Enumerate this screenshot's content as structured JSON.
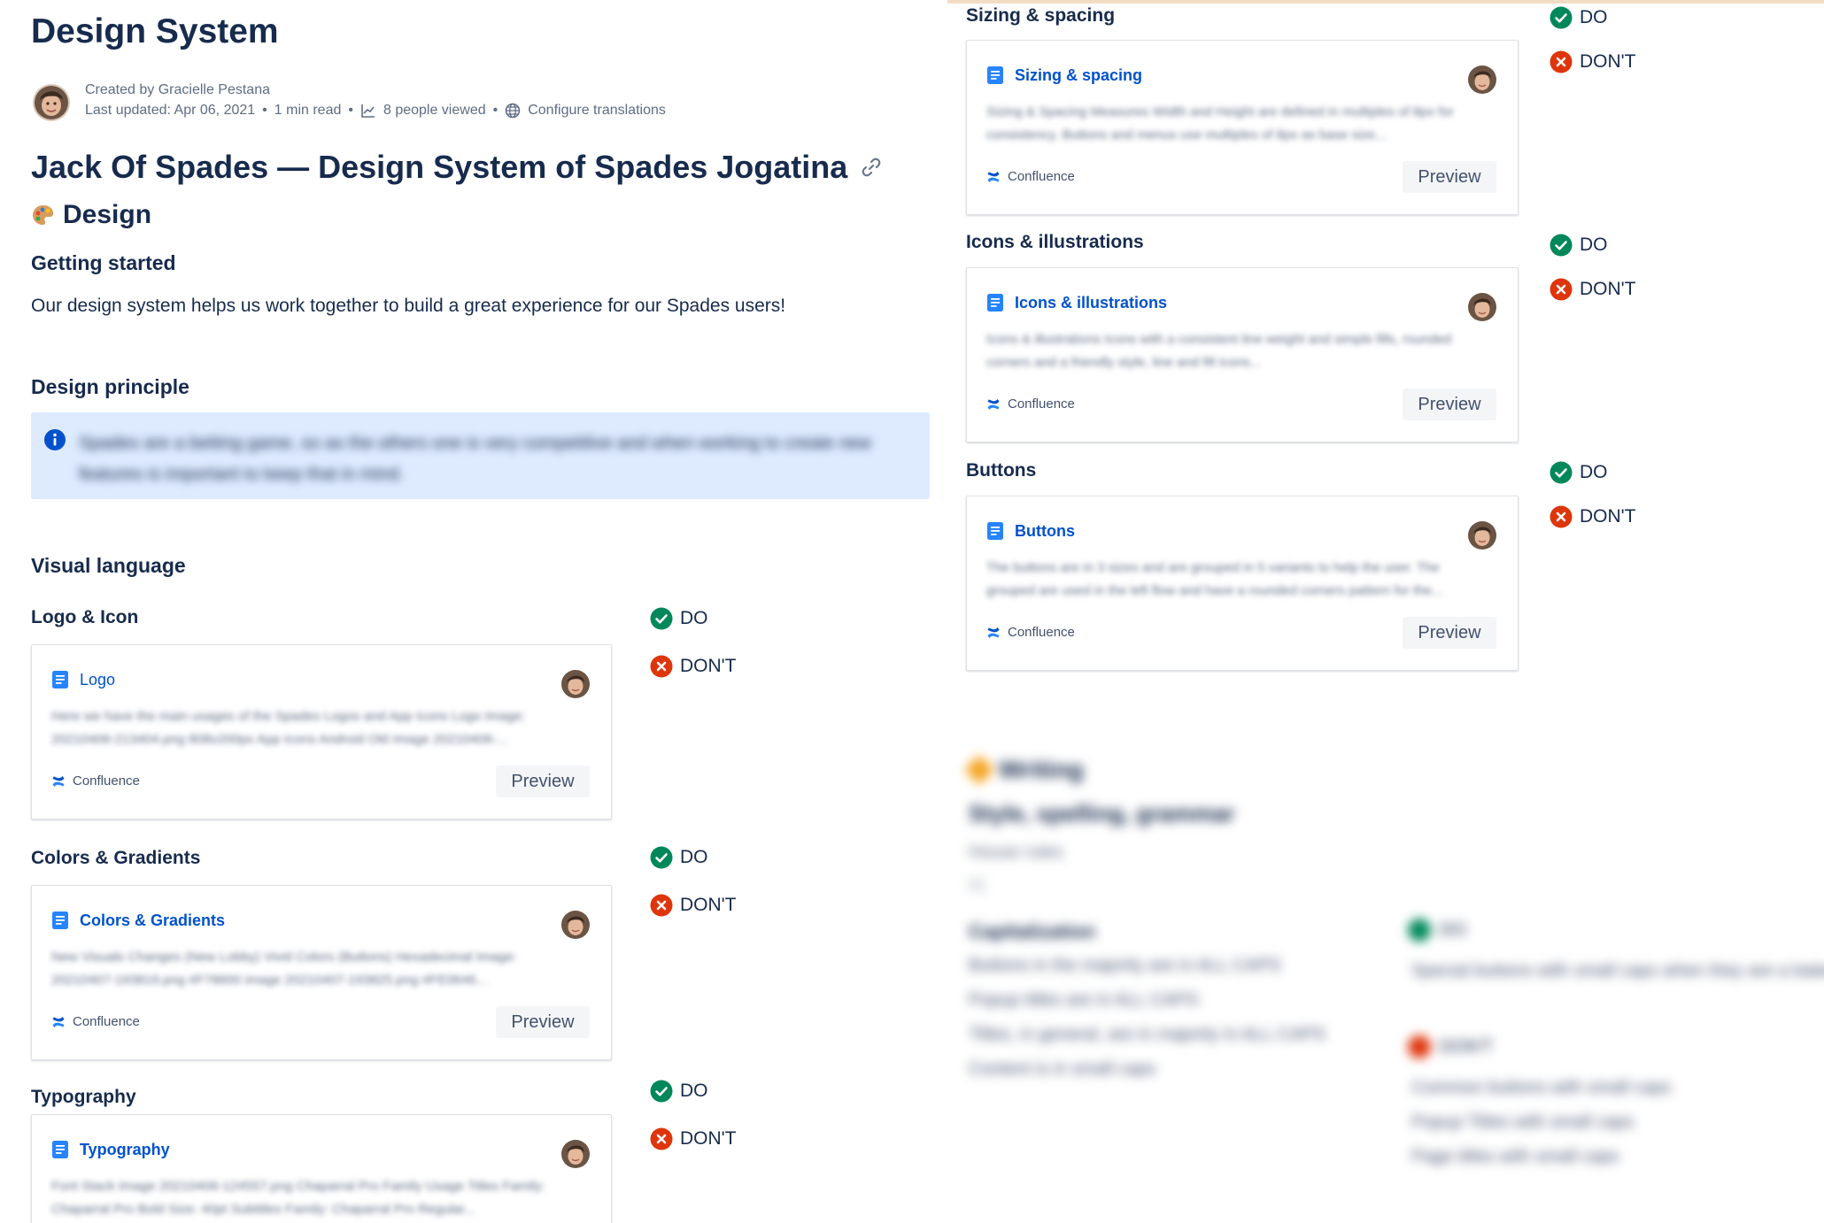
{
  "page": {
    "title": "Design System",
    "byline": {
      "created_by": "Created by Gracielle Pestana",
      "last_updated": "Last updated: Apr 06, 2021",
      "read_time": "1 min read",
      "views": "8 people viewed",
      "translations": "Configure translations"
    },
    "doc_title": "Jack Of Spades — Design System of Spades Jogatina",
    "design_heading": "Design",
    "getting_started": "Getting started",
    "intro": "Our design system helps us work together to build a great experience for our Spades users!",
    "design_principle": "Design principle",
    "info_panel": "Spades are a betting game, so as the others one is very competitive and when working to create new features is important to keep that in mind.",
    "visual_language": "Visual language"
  },
  "labels": {
    "do": "DO",
    "dont": "DON'T",
    "source": "Confluence",
    "preview": "Preview"
  },
  "sections": [
    {
      "heading": "Logo & Icon",
      "card_title": "Logo",
      "excerpt": "Here we have the main usages of the Spades Logos and App Icons Logo Image: 20210406-213404.png 808x200px App Icons Android Old Image 20210406-..."
    },
    {
      "heading": "Colors & Gradients",
      "card_title": "Colors & Gradients",
      "excerpt": "New Visuals Changes (New Lobby) Vivid Colors (Buttons) Hexadecimal Image: 20210407-193819.png #F78600 image 20210407-193825.png #FE0646..."
    },
    {
      "heading": "Typography",
      "card_title": "Typography",
      "excerpt": "Font Stack Image 20210406-124557.png Chaparral Pro Family Usage Titles Family: Chaparral Pro Bold Size: 40pt Subtitles Family: Chaparral Pro Regular..."
    },
    {
      "heading": "Sizing & spacing",
      "card_title": "Sizing & spacing",
      "excerpt": "Sizing & Spacing Measures Width and Height are defined in multiples of 8px for consistency. Buttons and menus use multiples of 8px as base size..."
    },
    {
      "heading": "Icons & illustrations",
      "card_title": "Icons & illustrations",
      "excerpt": "Icons & illustrations Icons with a consistent line weight and simple fills, rounded corners and a friendly style, line and fill icons..."
    },
    {
      "heading": "Buttons",
      "card_title": "Buttons",
      "excerpt": "The buttons are in 3 sizes and are grouped in 5 variants to help the user. The grouped are used in the left flow and have a rounded corners pattern for the..."
    }
  ],
  "blurred_section": {
    "title": "Writing",
    "subtitle": "Style, spelling, grammar",
    "house_rules": "House rules",
    "number": "01",
    "capitalization": "Capitalization",
    "left_items": [
      "Buttons in the majority are in ALL CAPS",
      "Popup titles are in ALL CAPS",
      "Titles, in general, are in majority in ALL CAPS",
      "Content is in small caps"
    ],
    "do": "DO",
    "do_items": [
      "Special buttons with small caps when they are a balance"
    ],
    "dont": "DON'T",
    "dont_items": [
      "Common buttons with small caps",
      "Popup Titles with small caps",
      "Page titles with small caps"
    ]
  },
  "colors": {
    "accent_blue": "#0052cc",
    "text_dark": "#172b4d",
    "info_bg": "#deebff",
    "success": "#00875a",
    "error": "#de350b"
  }
}
